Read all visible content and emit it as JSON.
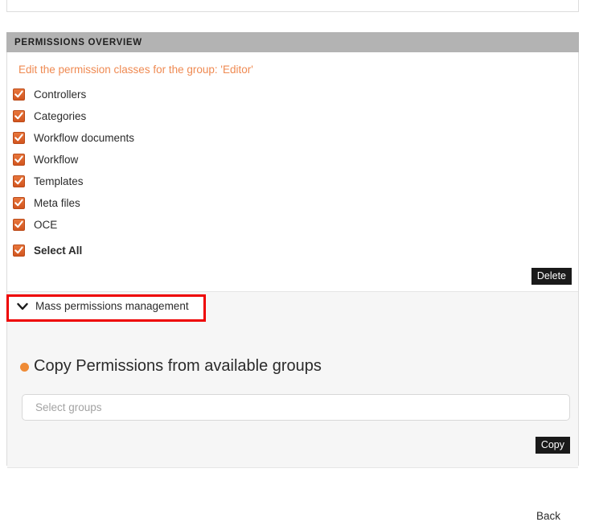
{
  "panel": {
    "header_title": "PERMISSIONS OVERVIEW",
    "intro_note": "Edit the permission classes for the group: 'Editor'"
  },
  "permissions": {
    "items": [
      {
        "label": "Controllers",
        "checked": true
      },
      {
        "label": "Categories",
        "checked": true
      },
      {
        "label": "Workflow documents",
        "checked": true
      },
      {
        "label": "Workflow",
        "checked": true
      },
      {
        "label": "Templates",
        "checked": true
      },
      {
        "label": "Meta files",
        "checked": true
      },
      {
        "label": "OCE",
        "checked": true
      }
    ],
    "select_all_label": "Select All",
    "delete_label": "Delete"
  },
  "mass_section": {
    "toggle_label": "Mass permissions management",
    "toggle_icon": "chevron-down-icon",
    "highlighted": true,
    "copy_title": "Copy Permissions from available groups",
    "copy_title_bullet": "orange-dot-icon",
    "select_groups_placeholder": "Select groups",
    "select_groups_value": "",
    "copy_label": "Copy"
  },
  "footer": {
    "back_label": "Back"
  },
  "colors": {
    "header_bar": "#b3b3b3",
    "accent_orange": "#ef8a52",
    "checkbox_orange": "#d2551f",
    "bullet_orange": "#ef8b36",
    "button_dark": "#1a1a1a",
    "highlight_red": "#ee0000",
    "section_bg": "#f6f6f6"
  }
}
